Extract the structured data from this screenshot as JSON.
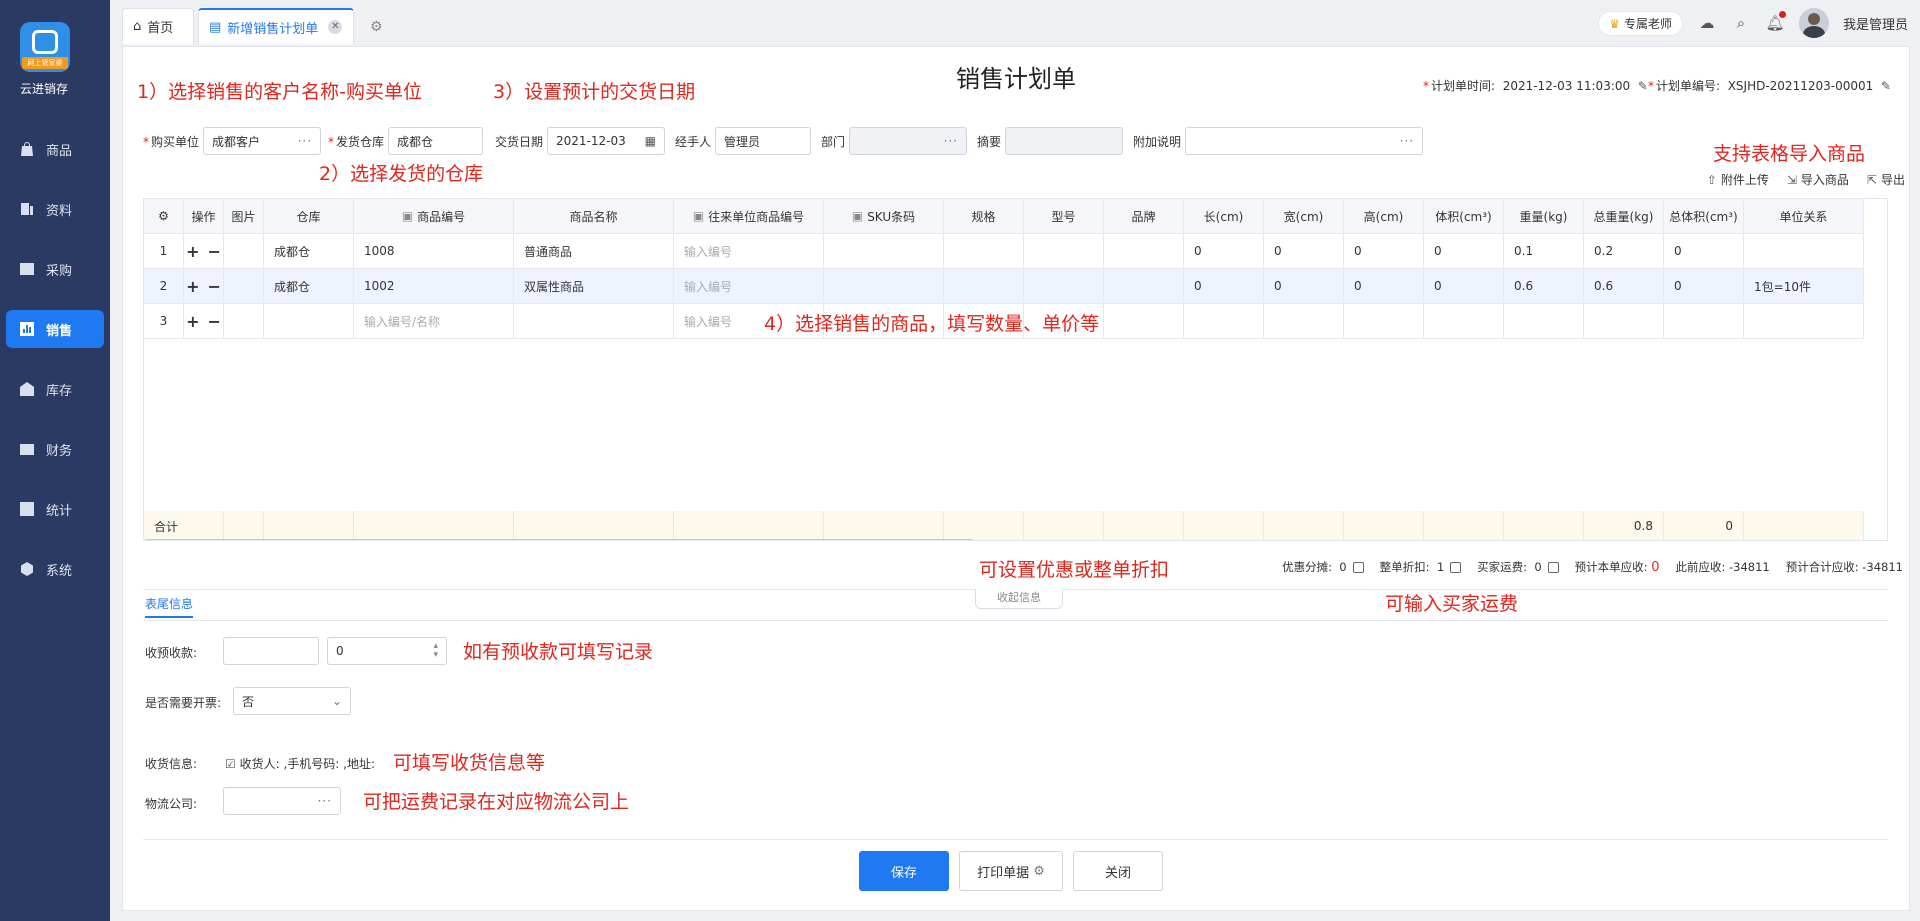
{
  "sidebar": {
    "brand": "云进销存",
    "logo_tag": "网上管家婆",
    "items": [
      {
        "label": "商品",
        "icon": "bag-icon"
      },
      {
        "label": "资料",
        "icon": "document-icon"
      },
      {
        "label": "采购",
        "icon": "purchase-icon"
      },
      {
        "label": "销售",
        "icon": "chart-icon"
      },
      {
        "label": "库存",
        "icon": "warehouse-icon"
      },
      {
        "label": "财务",
        "icon": "wallet-icon"
      },
      {
        "label": "统计",
        "icon": "trend-icon"
      },
      {
        "label": "系统",
        "icon": "settings-icon"
      }
    ],
    "active_index": 3
  },
  "tabs": {
    "home": "首页",
    "active": "新增销售计划单"
  },
  "topbar": {
    "expert": "专属老师",
    "user": "我是管理员"
  },
  "form": {
    "title": "销售计划单",
    "plan_time_label": "计划单时间:",
    "plan_time": "2021-12-03 11:03:00",
    "plan_no_label": "计划单编号:",
    "plan_no": "XSJHD-20211203-00001",
    "buyer_label": "购买单位",
    "buyer": "成都客户",
    "warehouse_label": "发货仓库",
    "warehouse": "成都仓",
    "delivery_label": "交货日期",
    "delivery": "2021-12-03",
    "handler_label": "经手人",
    "handler": "管理员",
    "dept_label": "部门",
    "summary_label": "摘要",
    "note_label": "附加说明"
  },
  "actions": {
    "upload": "附件上传",
    "import": "导入商品",
    "export": "导出"
  },
  "table": {
    "headers": [
      "操作",
      "图片",
      "仓库",
      "商品编号",
      "商品名称",
      "往来单位商品编号",
      "SKU条码",
      "规格",
      "型号",
      "品牌",
      "长(cm)",
      "宽(cm)",
      "高(cm)",
      "体积(cm³)",
      "重量(kg)",
      "总重量(kg)",
      "总体积(cm³)",
      "单位关系"
    ],
    "rows": [
      {
        "no": "1",
        "warehouse": "成都仓",
        "code": "1008",
        "name": "普通商品",
        "partner_code": "输入编号",
        "len": "0",
        "wid": "0",
        "hei": "0",
        "vol": "0",
        "weight": "0.1",
        "total_weight": "0.2",
        "total_vol": "0",
        "unit": ""
      },
      {
        "no": "2",
        "warehouse": "成都仓",
        "code": "1002",
        "name": "双属性商品",
        "partner_code": "输入编号",
        "len": "0",
        "wid": "0",
        "hei": "0",
        "vol": "0",
        "weight": "0.6",
        "total_weight": "0.6",
        "total_vol": "0",
        "unit": "1包=10件"
      },
      {
        "no": "3",
        "warehouse": "",
        "code": "输入编号/名称",
        "name": "",
        "partner_code": "输入编号",
        "len": "",
        "wid": "",
        "hei": "",
        "vol": "",
        "weight": "",
        "total_weight": "",
        "total_vol": "",
        "unit": ""
      }
    ],
    "sum_label": "合计",
    "sum_total_weight": "0.8",
    "sum_total_vol": "0"
  },
  "summary": {
    "discount_label": "优惠分摊:",
    "discount": "0",
    "whole_label": "整单折扣:",
    "whole": "1",
    "freight_label": "买家运费:",
    "freight": "0",
    "expected_label": "预计本单应收:",
    "expected": "0",
    "prev_label": "此前应收:",
    "prev": "-34811",
    "total_label": "预计合计应收:",
    "total": "-34811"
  },
  "footer": {
    "tab": "表尾信息",
    "collapse": "收起信息",
    "prepay_label": "收预收款:",
    "prepay_value": "0",
    "invoice_label": "是否需要开票:",
    "invoice_value": "否",
    "receiver_label": "收货信息:",
    "receiver_value": "收货人: ,手机号码: ,地址:",
    "logistics_label": "物流公司:"
  },
  "buttons": {
    "save": "保存",
    "print": "打印单据",
    "close": "关闭"
  },
  "annotations": {
    "a1": "1）选择销售的客户名称-购买单位",
    "a2": "2）选择发货的仓库",
    "a3": "3）设置预计的交货日期",
    "a4": "4）选择销售的商品，填写数量、单价等",
    "a5": "支持表格导入商品",
    "a6": "可设置优惠或整单折扣",
    "a7": "可输入买家运费",
    "a8": "如有预收款可填写记录",
    "a9": "可填写收货信息等",
    "a10": "可把运费记录在对应物流公司上"
  },
  "colors": {
    "sidebar": "#2b3a63",
    "accent": "#1f7af2",
    "annotation": "#e0261d"
  }
}
